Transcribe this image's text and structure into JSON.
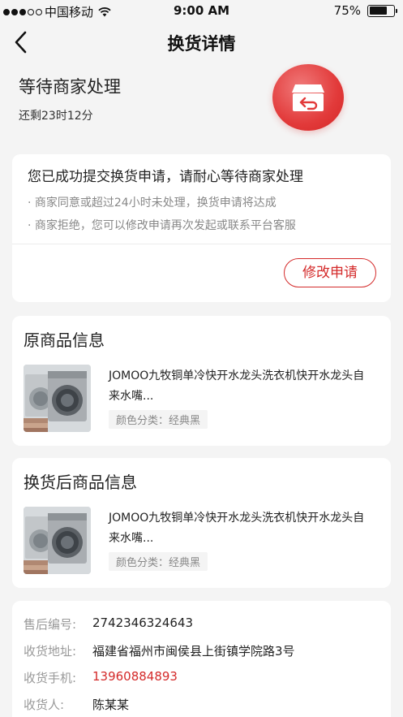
{
  "status_bar": {
    "carrier": "中国移动",
    "time": "9:00 AM",
    "battery": "75%",
    "battery_level": 0.75
  },
  "nav": {
    "title": "换货详情",
    "back_icon": "chevron-left-icon"
  },
  "state": {
    "title": "等待商家处理",
    "countdown": "还剩23时12分",
    "icon": "return-box-icon",
    "accent_color": "#e23a3a"
  },
  "notice": {
    "title": "您已成功提交换货申请，请耐心等待商家处理",
    "lines": [
      "· 商家同意或超过24小时未处理，换货申请将达成",
      "· 商家拒绝，您可以修改申请再次发起或联系平台客服"
    ],
    "modify_button": "修改申请"
  },
  "original_product": {
    "section_title": "原商品信息",
    "name": "JOMOO九牧铜单冷快开水龙头洗衣机快开水龙头自来水嘴...",
    "spec": "颜色分类：经典黑"
  },
  "exchange_product": {
    "section_title": "换货后商品信息",
    "name": "JOMOO九牧铜单冷快开水龙头洗衣机快开水龙头自来水嘴...",
    "spec": "颜色分类：经典黑"
  },
  "order_info": {
    "rows": [
      {
        "label": "售后编号:",
        "value": "2742346324643"
      },
      {
        "label": "收货地址:",
        "value": "福建省福州市闽侯县上街镇学院路3号"
      },
      {
        "label": "收货手机:",
        "value": "13960884893"
      },
      {
        "label": "收货人:",
        "value": "陈某某"
      }
    ]
  }
}
